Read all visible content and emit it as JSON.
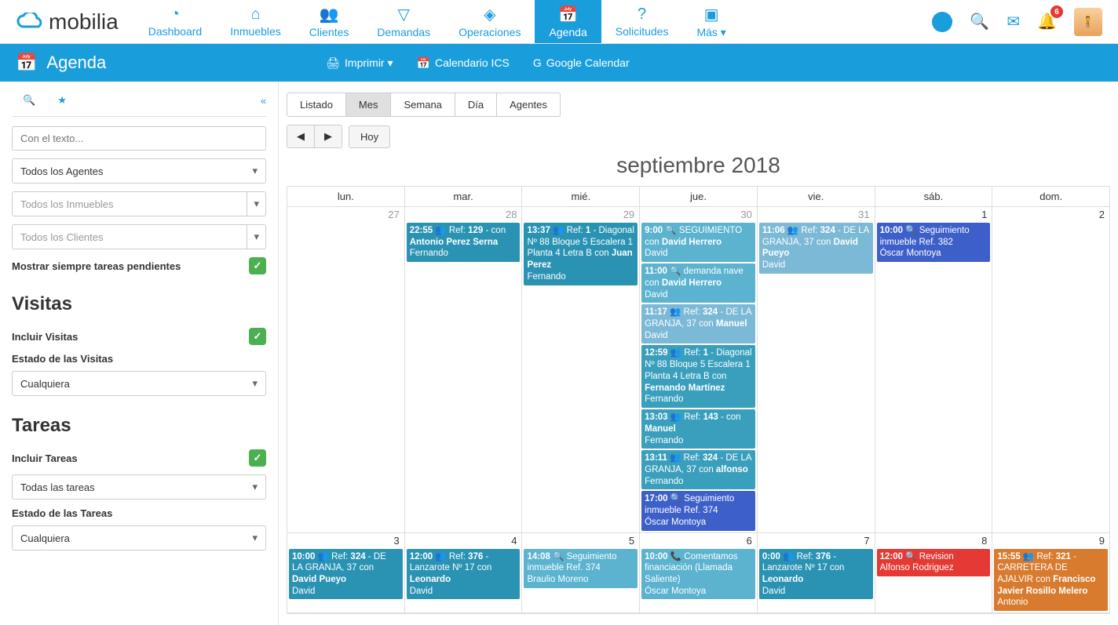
{
  "brand": "mobilia",
  "nav": [
    {
      "label": "Dashboard",
      "icon": "◔"
    },
    {
      "label": "Inmuebles",
      "icon": "⌂"
    },
    {
      "label": "Clientes",
      "icon": "👥"
    },
    {
      "label": "Demandas",
      "icon": "▽"
    },
    {
      "label": "Operaciones",
      "icon": "◈"
    },
    {
      "label": "Agenda",
      "icon": "📅",
      "active": true
    },
    {
      "label": "Solicitudes",
      "icon": "?"
    },
    {
      "label": "Más ▾",
      "icon": "▣"
    }
  ],
  "notif_count": "6",
  "subheader": {
    "title": "Agenda",
    "print": "Imprimir ▾",
    "ics": "Calendario ICS",
    "gcal": "Google Calendar"
  },
  "sidebar": {
    "search_ph": "Con el texto...",
    "agents": "Todos los Agentes",
    "props": "Todos los Inmuebles",
    "clients": "Todos los Clientes",
    "pending": "Mostrar siempre tareas pendientes",
    "visits_h": "Visitas",
    "inc_visits": "Incluir Visitas",
    "state_visits": "Estado de las Visitas",
    "any": "Cualquiera",
    "tasks_h": "Tareas",
    "inc_tasks": "Incluir Tareas",
    "all_tasks": "Todas las tareas",
    "state_tasks": "Estado de las Tareas"
  },
  "views": [
    "Listado",
    "Mes",
    "Semana",
    "Día",
    "Agentes"
  ],
  "active_view": "Mes",
  "today": "Hoy",
  "cal_title": "septiembre 2018",
  "dow": [
    "lun.",
    "mar.",
    "mié.",
    "jue.",
    "vie.",
    "sáb.",
    "dom."
  ],
  "weeks": [
    {
      "days": [
        {
          "n": "27",
          "out": true,
          "ev": []
        },
        {
          "n": "28",
          "out": true,
          "ev": [
            {
              "c": "c-teal",
              "h": "<b>22:55</b> 👥 Ref: <b>129</b> - con <b>Antonio Perez Serna</b><br>Fernando"
            }
          ]
        },
        {
          "n": "29",
          "out": true,
          "ev": [
            {
              "c": "c-teal",
              "h": "<b>13:37</b> 👥 Ref: <b>1</b> - Diagonal Nº 88 Bloque 5 Escalera 1 Planta 4 Letra B con <b>Juan Perez</b><br>Fernando"
            }
          ]
        },
        {
          "n": "30",
          "out": true,
          "ev": [
            {
              "c": "c-ltblue",
              "h": "<b>9:00</b> 🔍 SEGUIMIENTO con <b>David Herrero</b><br>David"
            },
            {
              "c": "c-ltblue",
              "h": "<b>11:00</b> 🔍 demanda nave con <b>David Herrero</b><br>David"
            },
            {
              "c": "c-skyblue",
              "h": "<b>11:17</b> 👥 Ref: <b>324</b> - DE LA GRANJA, 37 con <b>Manuel</b><br>David"
            },
            {
              "c": "c-teal2",
              "h": "<b>12:59</b> 👥 Ref: <b>1</b> - Diagonal Nº 88 Bloque 5 Escalera 1 Planta 4 Letra B con <b>Fernando Martínez</b><br>Fernando"
            },
            {
              "c": "c-teal2",
              "h": "<b>13:03</b> 👥 Ref: <b>143</b> - con <b>Manuel</b><br>Fernando"
            },
            {
              "c": "c-teal2",
              "h": "<b>13:11</b> 👥 Ref: <b>324</b> - DE LA GRANJA, 37 con <b>alfonso</b><br>Fernando"
            },
            {
              "c": "c-blue",
              "h": "<b>17:00</b> 🔍 Seguimiento inmueble Ref. 374<br>Óscar Montoya"
            }
          ]
        },
        {
          "n": "31",
          "out": true,
          "ev": [
            {
              "c": "c-skyblue",
              "h": "<b>11:06</b> 👥 Ref: <b>324</b> - DE LA GRANJA, 37 con <b>David Pueyo</b><br>David"
            }
          ]
        },
        {
          "n": "1",
          "ev": [
            {
              "c": "c-blue",
              "h": "<b>10:00</b> 🔍 Seguimiento inmueble Ref. 382<br>Óscar Montoya"
            }
          ]
        },
        {
          "n": "2",
          "ev": []
        }
      ]
    },
    {
      "days": [
        {
          "n": "3",
          "ev": [
            {
              "c": "c-teal",
              "h": "<b>10:00</b> 👥 Ref: <b>324</b> - DE LA GRANJA, 37 con <b>David Pueyo</b><br>David"
            }
          ]
        },
        {
          "n": "4",
          "ev": [
            {
              "c": "c-teal",
              "h": "<b>12:00</b> 👥 Ref: <b>376</b> - Lanzarote Nº 17 con <b>Leonardo</b><br>David"
            }
          ]
        },
        {
          "n": "5",
          "ev": [
            {
              "c": "c-ltblue",
              "h": "<b>14:08</b> 🔍 Seguimiento inmueble Ref. 374<br>Braulio Moreno"
            }
          ]
        },
        {
          "n": "6",
          "ev": [
            {
              "c": "c-ltblue",
              "h": "<b>10:00</b> 📞 Comentamos financiación (Llamada Saliente)<br>Óscar Montoya"
            }
          ]
        },
        {
          "n": "7",
          "ev": [
            {
              "c": "c-teal",
              "h": "<b>0:00</b> 👥 Ref: <b>376</b> - Lanzarote Nº 17 con <b>Leonardo</b><br>David"
            }
          ]
        },
        {
          "n": "8",
          "ev": [
            {
              "c": "c-red",
              "h": "<b>12:00</b> 🔍 Revision<br>Alfonso Rodriguez"
            }
          ]
        },
        {
          "n": "9",
          "ev": [
            {
              "c": "c-orange",
              "h": "<b>15:55</b> 👥 Ref: <b>321</b> - CARRETERA DE AJALVIR con <b>Francisco Javier Rosillo Melero</b><br>Antonio"
            }
          ]
        }
      ]
    }
  ]
}
